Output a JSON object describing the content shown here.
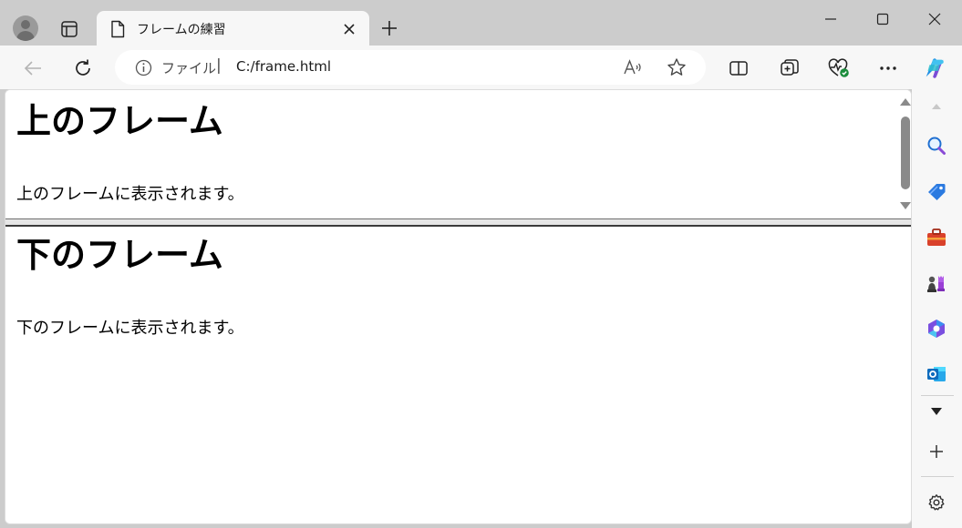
{
  "tab": {
    "title": "フレームの練習"
  },
  "address": {
    "site_label": "ファイル",
    "separator": "|",
    "url": "C:/frame.html"
  },
  "frames": {
    "top": {
      "heading": "上のフレーム",
      "text": "上のフレームに表示されます。"
    },
    "bottom": {
      "heading": "下のフレーム",
      "text": "下のフレームに表示されます。"
    }
  },
  "icons": {
    "titlebar": [
      "profile-icon",
      "tab-actions-icon",
      "page-icon",
      "close-tab-icon",
      "new-tab-icon",
      "minimize-icon",
      "maximize-icon",
      "close-window-icon"
    ],
    "toolbar": [
      "back-icon",
      "refresh-icon",
      "info-icon",
      "read-aloud-icon",
      "favorite-star-icon",
      "split-screen-icon",
      "collections-icon",
      "browser-essentials-icon",
      "more-icon",
      "copilot-icon"
    ],
    "sidebar": [
      "search-icon",
      "shopping-icon",
      "tools-icon",
      "games-icon",
      "microsoft-365-icon",
      "outlook-icon",
      "more-apps-icon",
      "add-icon",
      "settings-icon"
    ]
  },
  "colors": {
    "chrome_bg": "#cccccc",
    "toolbar_bg": "#f7f7f7",
    "content_bg": "#ffffff",
    "frame_border": "#3a3a3a",
    "copilot_accent": "#1f8fe5"
  }
}
